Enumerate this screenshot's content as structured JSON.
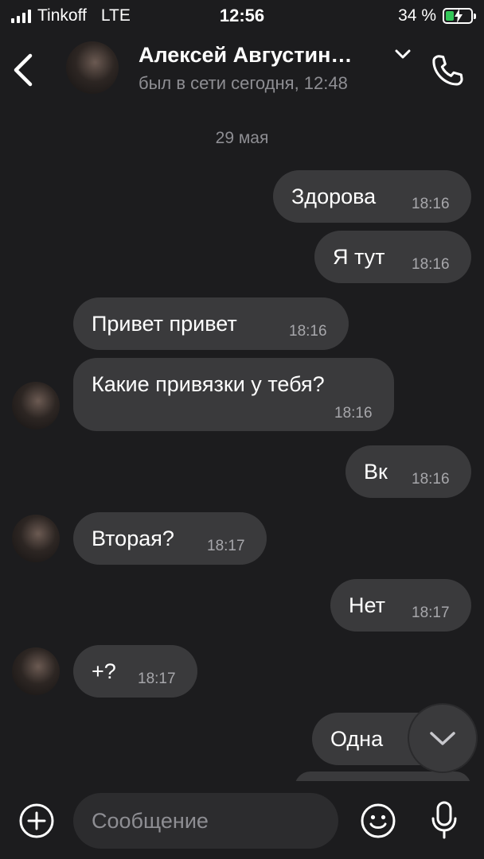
{
  "status_bar": {
    "carrier": "Tinkoff",
    "network": "LTE",
    "time": "12:56",
    "battery_percent": "34 %",
    "battery_level": 0.34,
    "battery_color": "#34c759"
  },
  "header": {
    "contact_name": "Алексей Августин…",
    "contact_status": "был в сети сегодня, 12:48",
    "icons": [
      "back-icon",
      "chevron-down-icon",
      "phone-icon"
    ]
  },
  "date_separator": "29 мая",
  "messages": [
    {
      "direction": "out",
      "text": "Здорова",
      "time": "18:16"
    },
    {
      "direction": "out",
      "text": "Я тут",
      "time": "18:16"
    },
    {
      "direction": "in",
      "text": "Привет привет",
      "time": "18:16"
    },
    {
      "direction": "in",
      "text": "Какие привязки у тебя?",
      "time": "18:16"
    },
    {
      "direction": "out",
      "text": "Вк",
      "time": "18:16"
    },
    {
      "direction": "in",
      "text": "Вторая?",
      "time": "18:17"
    },
    {
      "direction": "out",
      "text": "Нет",
      "time": "18:17"
    },
    {
      "direction": "in",
      "text": "+?",
      "time": "18:17"
    },
    {
      "direction": "out",
      "text": "Одна",
      "time": ""
    }
  ],
  "composer": {
    "placeholder": "Сообщение",
    "icons": [
      "add-icon",
      "emoji-icon",
      "mic-icon"
    ]
  },
  "scroll_down": {
    "icon": "chevron-down-icon"
  },
  "colors": {
    "background": "#1c1c1e",
    "bubble": "#3a3a3c",
    "secondary_text": "#8e8e93"
  }
}
